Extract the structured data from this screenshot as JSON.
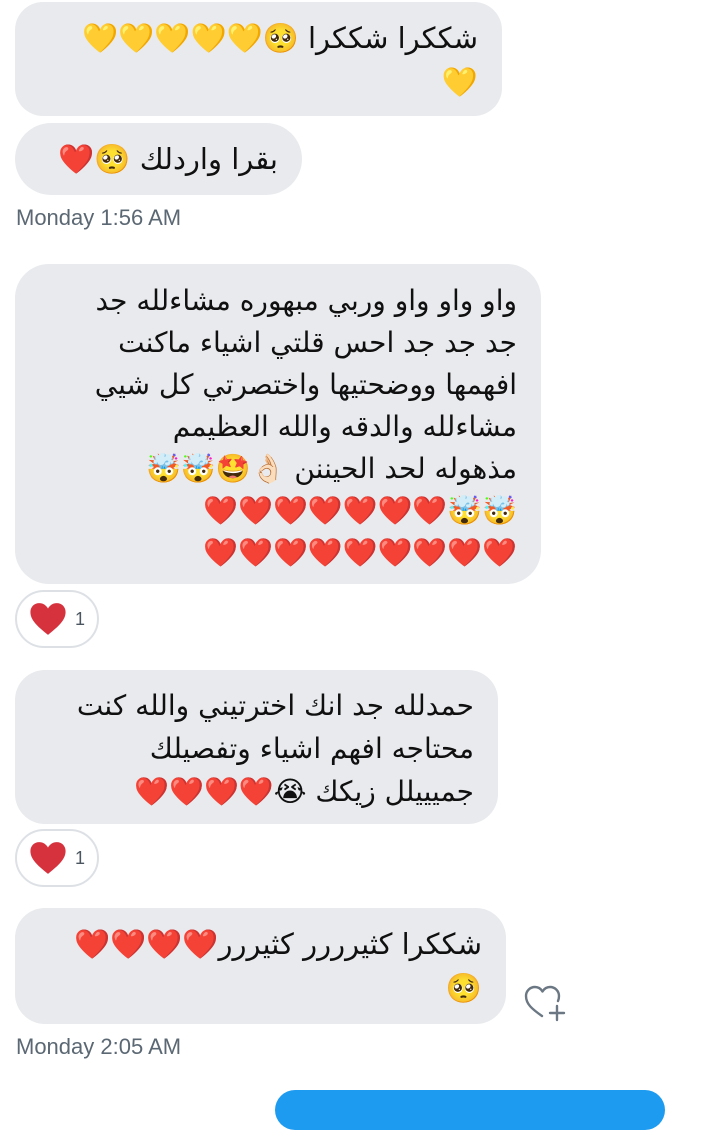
{
  "messages": [
    {
      "lines": [
        "شككرا شككرا 🥺💛💛💛💛💛",
        "💛"
      ]
    },
    {
      "lines": [
        "بقرا واردلك 🥺❤️"
      ]
    },
    {
      "lines": [
        "واو واو واو وربي مبهوره مشاءلله جد",
        "جد جد جد احس قلتي اشياء ماكنت",
        "افهمها ووضحتيها واختصرتي كل شيي",
        "مشاءلله والدقه والله العظيمم",
        "مذهوله لحد الحيننن 👌🏻🤩🤯🤯",
        "🤯🤯❤️❤️❤️❤️❤️❤️❤️",
        "❤️❤️❤️❤️❤️❤️❤️❤️❤️"
      ]
    },
    {
      "lines": [
        "حمدلله جد انك اخترتيني والله كنت",
        "محتاجه افهم اشياء وتفصيلك",
        "جميييلل زيكك 😭❤️❤️❤️❤️"
      ]
    },
    {
      "lines": [
        "شككرا كثيرررر كثيررر❤️❤️❤️❤️",
        "🥺"
      ]
    }
  ],
  "timestamps": [
    "Monday 1:56 AM",
    "Monday 2:05 AM"
  ],
  "reactions": [
    {
      "emoji": "heart",
      "count": "1"
    },
    {
      "emoji": "heart",
      "count": "1"
    }
  ],
  "colors": {
    "incoming_bubble": "#e8eaed",
    "outgoing_bubble": "#1d9bf0",
    "reaction_heart": "#d6323e",
    "timestamp_text": "#5b6873"
  }
}
